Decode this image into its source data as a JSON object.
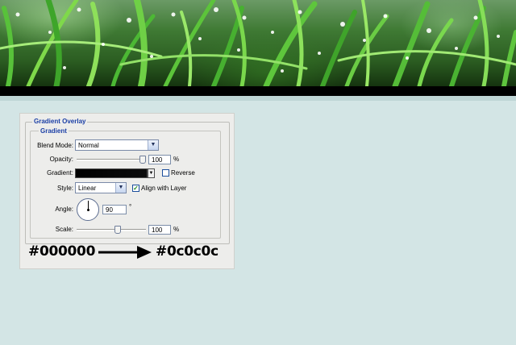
{
  "dialog": {
    "group_title": "Gradient Overlay",
    "subgroup_title": "Gradient",
    "blend_mode": {
      "label": "Blend Mode:",
      "value": "Normal"
    },
    "opacity": {
      "label": "Opacity:",
      "value": "100",
      "unit": "%",
      "level": 1.0
    },
    "gradient": {
      "label": "Gradient:",
      "start_color": "#000000",
      "end_color": "#0c0c0c"
    },
    "reverse": {
      "label": "Reverse",
      "checked": false
    },
    "style": {
      "label": "Style:",
      "value": "Linear"
    },
    "align_with_layer": {
      "label": "Align with Layer",
      "checked": true
    },
    "angle": {
      "label": "Angle:",
      "value": "90",
      "unit": "°"
    },
    "scale": {
      "label": "Scale:",
      "value": "100",
      "unit": "%",
      "level": 0.5
    }
  },
  "annotation": {
    "from_color": "#000000",
    "to_color": "#0c0c0c",
    "from_text": "#000000",
    "to_text": "#0c0c0c"
  },
  "colors": {
    "page_background": "#d3e5e5",
    "legend_text": "#1b3fa6"
  },
  "icons": [
    "chevron-down-icon",
    "checkmark-icon",
    "arrow-right-icon"
  ]
}
